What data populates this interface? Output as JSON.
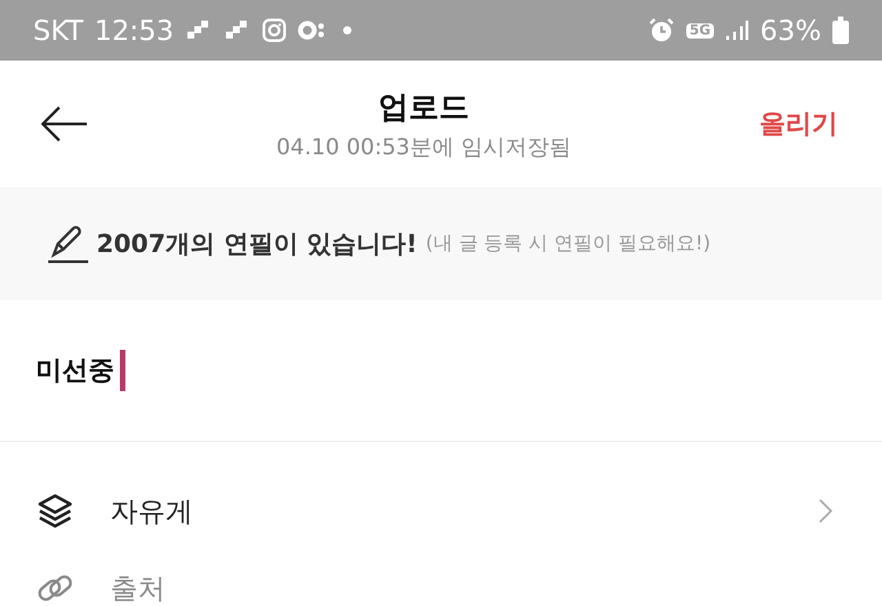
{
  "status_bar": {
    "carrier": "SKT",
    "time": "12:53",
    "network": "5G",
    "battery": "63%"
  },
  "header": {
    "title": "업로드",
    "subtitle": "04.10 00:53분에 임시저장됨",
    "action": "올리기"
  },
  "banner": {
    "text": "2007개의 연필이 있습니다!",
    "note": "(내 글 등록 시 연필이 필요해요!)"
  },
  "title_field": {
    "value": "미선중"
  },
  "options": [
    {
      "kind": "board",
      "label": "자유게",
      "disabled": false
    },
    {
      "kind": "source",
      "label": "출처",
      "disabled": true
    }
  ]
}
